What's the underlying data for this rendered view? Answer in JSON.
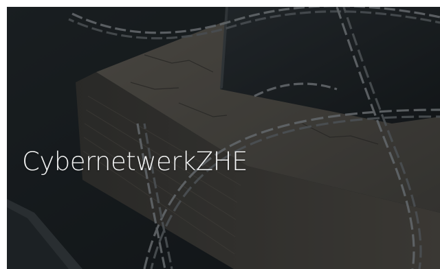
{
  "hero": {
    "title": "CybernetwerkZHE",
    "background_image": "book-and-phone-locked-with-chains",
    "overlay_color": "#14181b",
    "title_color": "#f2f3f3"
  }
}
